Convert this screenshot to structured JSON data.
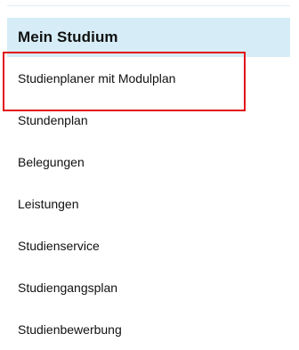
{
  "menu": {
    "title": "Mein Studium",
    "items": [
      {
        "label": "Studienplaner mit Modulplan",
        "highlighted": true
      },
      {
        "label": "Stundenplan"
      },
      {
        "label": "Belegungen"
      },
      {
        "label": "Leistungen"
      },
      {
        "label": "Studienservice"
      },
      {
        "label": "Studiengangsplan"
      },
      {
        "label": "Studienbewerbung"
      }
    ]
  },
  "colors": {
    "header_background": "#d6ecf6",
    "highlight_border": "#e2101a",
    "text": "#111111"
  }
}
